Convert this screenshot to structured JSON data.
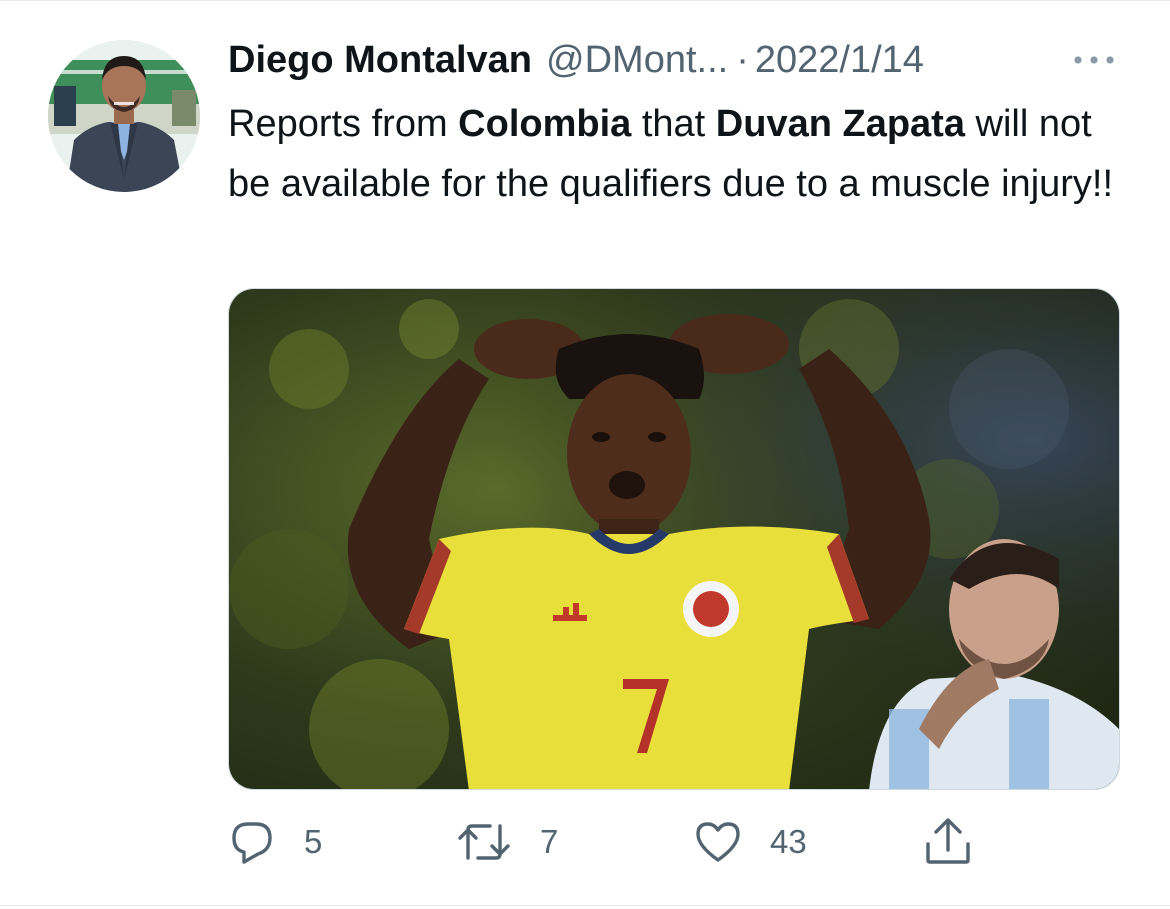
{
  "tweet": {
    "author": {
      "display_name": "Diego Montalvan",
      "handle": "@DMont...",
      "avatar_icon": "profile-avatar"
    },
    "separator": "·",
    "date": "2022/1/14",
    "text_segments": {
      "s1": "Reports from ",
      "s2": "Colombia",
      "s3": " that ",
      "s4": "Duvan Zapata",
      "s5": " will not be available for the qualifiers due to a muscle injury!!"
    },
    "media": {
      "icon": "photo-football-player"
    },
    "actions": {
      "reply": {
        "icon": "reply-icon",
        "count": "5"
      },
      "retweet": {
        "icon": "retweet-icon",
        "count": "7"
      },
      "like": {
        "icon": "heart-icon",
        "count": "43"
      },
      "share": {
        "icon": "share-icon"
      }
    },
    "more_icon": "more-icon"
  },
  "colors": {
    "text_primary": "#0f1419",
    "text_secondary": "#536471",
    "border": "#cfd9de"
  }
}
